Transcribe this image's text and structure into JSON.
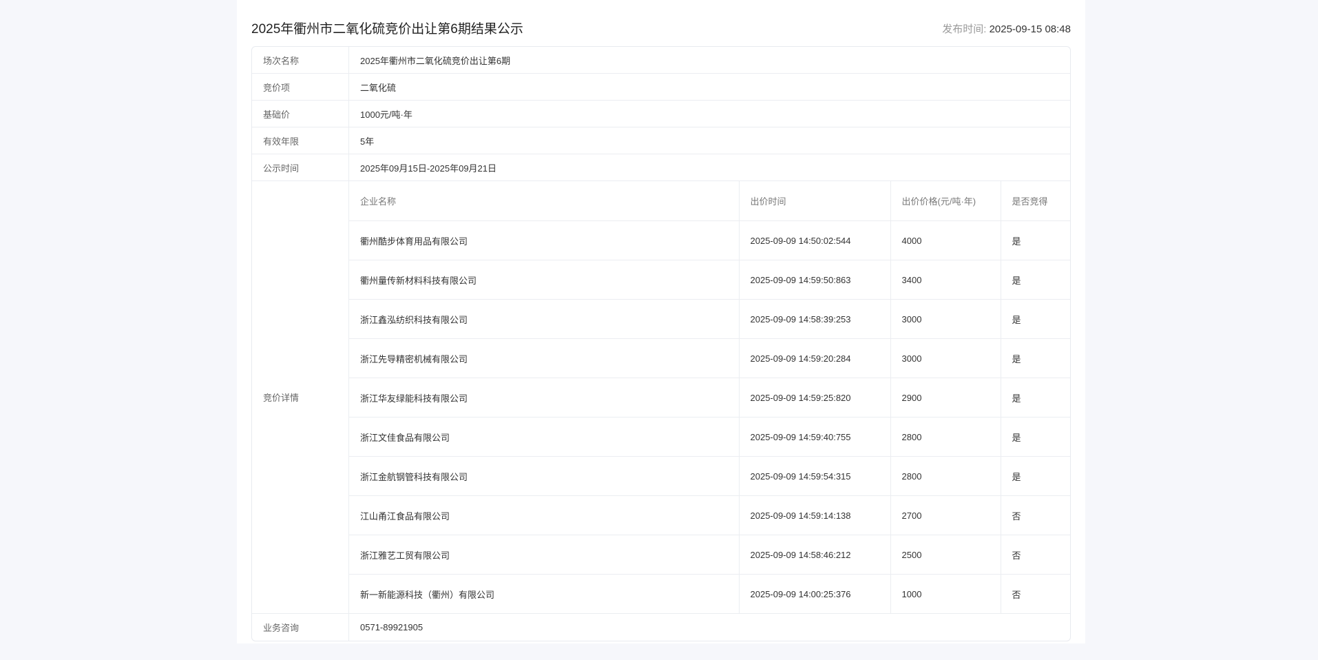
{
  "title": "2025年衢州市二氧化硫竞价出让第6期结果公示",
  "publish": {
    "label": "发布时间:",
    "value": "2025-09-15 08:48"
  },
  "info": {
    "session_name": {
      "label": "场次名称",
      "value": "2025年衢州市二氧化硫竞价出让第6期"
    },
    "bid_item": {
      "label": "竞价项",
      "value": "二氧化硫"
    },
    "base_price": {
      "label": "基础价",
      "value": "1000元/吨·年"
    },
    "valid_years": {
      "label": "有效年限",
      "value": "5年"
    },
    "notice_period": {
      "label": "公示时间",
      "value": "2025年09月15日-2025年09月21日"
    },
    "details_label": "竞价详情",
    "consult": {
      "label": "业务咨询",
      "value": "0571-89921905"
    }
  },
  "bids": {
    "headers": {
      "company": "企业名称",
      "time": "出价时间",
      "price": "出价价格(元/吨·年)",
      "won": "是否竞得"
    },
    "rows": [
      {
        "company": "衢州酷步体育用品有限公司",
        "time": "2025-09-09 14:50:02:544",
        "price": "4000",
        "won": "是"
      },
      {
        "company": "衢州量传新材料科技有限公司",
        "time": "2025-09-09 14:59:50:863",
        "price": "3400",
        "won": "是"
      },
      {
        "company": "浙江鑫泓纺织科技有限公司",
        "time": "2025-09-09 14:58:39:253",
        "price": "3000",
        "won": "是"
      },
      {
        "company": "浙江先导精密机械有限公司",
        "time": "2025-09-09 14:59:20:284",
        "price": "3000",
        "won": "是"
      },
      {
        "company": "浙江华友绿能科技有限公司",
        "time": "2025-09-09 14:59:25:820",
        "price": "2900",
        "won": "是"
      },
      {
        "company": "浙江文佳食品有限公司",
        "time": "2025-09-09 14:59:40:755",
        "price": "2800",
        "won": "是"
      },
      {
        "company": "浙江金航钢管科技有限公司",
        "time": "2025-09-09 14:59:54:315",
        "price": "2800",
        "won": "是"
      },
      {
        "company": "江山甬江食品有限公司",
        "time": "2025-09-09 14:59:14:138",
        "price": "2700",
        "won": "否"
      },
      {
        "company": "浙江雅艺工贸有限公司",
        "time": "2025-09-09 14:58:46:212",
        "price": "2500",
        "won": "否"
      },
      {
        "company": "新一新能源科技（衢州）有限公司",
        "time": "2025-09-09 14:00:25:376",
        "price": "1000",
        "won": "否"
      }
    ]
  }
}
